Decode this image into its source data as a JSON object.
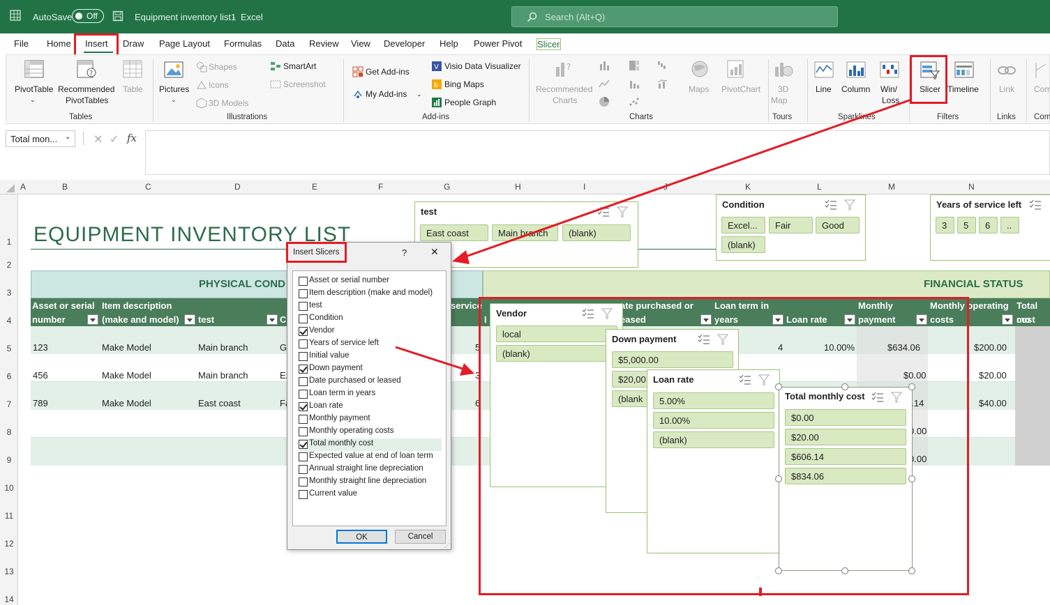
{
  "titlebar": {
    "autosave_label": "AutoSave",
    "autosave_state": "Off",
    "document_title": "Equipment inventory list1",
    "separator": "-",
    "app_name": "Excel",
    "search_placeholder": "Search (Alt+Q)"
  },
  "tabs": [
    "File",
    "Home",
    "Insert",
    "Draw",
    "Page Layout",
    "Formulas",
    "Data",
    "Review",
    "View",
    "Developer",
    "Help",
    "Power Pivot",
    "Slicer"
  ],
  "ribbon": {
    "tables": {
      "pivottable": "PivotTable",
      "recommended_1": "Recommended",
      "recommended_2": "PivotTables",
      "table": "Table",
      "group": "Tables"
    },
    "illustrations": {
      "pictures": "Pictures",
      "shapes": "Shapes",
      "icons": "Icons",
      "models": "3D Models",
      "smartart": "SmartArt",
      "screenshot": "Screenshot",
      "group": "Illustrations"
    },
    "addins": {
      "get": "Get Add-ins",
      "my": "My Add-ins",
      "visio": "Visio Data Visualizer",
      "bing": "Bing Maps",
      "people": "People Graph",
      "group": "Add-ins"
    },
    "charts": {
      "rec_1": "Recommended",
      "rec_2": "Charts",
      "maps": "Maps",
      "pivotchart": "PivotChart",
      "group": "Charts"
    },
    "tours": {
      "map_1": "3D",
      "map_2": "Map",
      "group": "Tours"
    },
    "sparklines": {
      "line": "Line",
      "column": "Column",
      "winloss_1": "Win/",
      "winloss_2": "Loss",
      "group": "Sparklines"
    },
    "filters": {
      "slicer": "Slicer",
      "timeline": "Timeline",
      "group": "Filters"
    },
    "links": {
      "link": "Link",
      "group": "Links"
    },
    "comments": {
      "com": "Com",
      "group": "Com"
    }
  },
  "formula": {
    "namebox": "Total mon...",
    "fx": "fx"
  },
  "columns": [
    "A",
    "B",
    "C",
    "D",
    "E",
    "F",
    "G",
    "H",
    "I",
    "J",
    "K",
    "L",
    "M",
    "N"
  ],
  "rows": [
    "1",
    "2",
    "3",
    "4",
    "5",
    "6",
    "7",
    "8",
    "9",
    "10",
    "11",
    "12",
    "13",
    "14"
  ],
  "sheet": {
    "title": "EQUIPMENT INVENTORY LIST",
    "physical": "PHYSICAL COND",
    "financial": "FINANCIAL STATUS",
    "headers": {
      "asset_1": "Asset or serial",
      "asset_2": "number",
      "item_1": "Item description",
      "item_2": "(make and model)",
      "test": "test",
      "c": "C",
      "service": "service",
      "i": "I",
      "date_1": "ate purchased or",
      "date_2": "eased",
      "loan_1": "Loan term in",
      "loan_2": "years",
      "rate": "Loan rate",
      "monthly_1": "Monthly",
      "monthly_2": "payment",
      "op_1": "Monthly operating",
      "op_2": "costs",
      "tot_1": "Total mo",
      "tot_2": "cost"
    },
    "data_rows": [
      {
        "asset": "123",
        "item": "Make Model",
        "test": "Main branch",
        "cond": "G",
        "g": "5",
        "loan_term": "4",
        "rate": "10.00%",
        "payment": "$634.06",
        "op": "$200.00"
      },
      {
        "asset": "456",
        "item": "Make Model",
        "test": "Main branch",
        "cond": "Ex",
        "g": "3",
        "loan_term": "",
        "rate": "",
        "payment": "$0.00",
        "op": "$20.00"
      },
      {
        "asset": "789",
        "item": "Make Model",
        "test": "East coast",
        "cond": "Fa",
        "g": "6",
        "loan_term": "",
        "rate": "",
        "payment": "5.14",
        "op": "$40.00"
      }
    ],
    "row8_m": "0.00",
    "row9_m": "0.00"
  },
  "slicers": {
    "test": {
      "title": "test",
      "items": [
        "East coast",
        "Main branch",
        "(blank)"
      ]
    },
    "condition": {
      "title": "Condition",
      "items": [
        "Excel...",
        "Fair",
        "Good",
        "(blank)"
      ]
    },
    "years": {
      "title": "Years of service left",
      "items": [
        "3",
        "5",
        "6",
        ".."
      ]
    },
    "vendor": {
      "title": "Vendor",
      "items": [
        "local",
        "(blank)"
      ]
    },
    "down": {
      "title": "Down payment",
      "items": [
        "$5,000.00",
        "$20,00",
        "(blank"
      ]
    },
    "loanrate": {
      "title": "Loan rate",
      "items": [
        "5.00%",
        "10.00%",
        "(blank)"
      ]
    },
    "total": {
      "title": "Total monthly cost",
      "items": [
        "$0.00",
        "$20.00",
        "$606.14",
        "$834.06"
      ]
    }
  },
  "dialog": {
    "title": "Insert Slicers",
    "help": "?",
    "close": "✕",
    "fields": [
      {
        "label": "Asset or serial number",
        "checked": false
      },
      {
        "label": "Item description (make and model)",
        "checked": false
      },
      {
        "label": "test",
        "checked": false
      },
      {
        "label": "Condition",
        "checked": false
      },
      {
        "label": "Vendor",
        "checked": true
      },
      {
        "label": "Years of service left",
        "checked": false
      },
      {
        "label": "Initial value",
        "checked": false
      },
      {
        "label": "Down payment",
        "checked": true
      },
      {
        "label": "Date purchased or leased",
        "checked": false
      },
      {
        "label": "Loan term in years",
        "checked": false
      },
      {
        "label": "Loan rate",
        "checked": true
      },
      {
        "label": "Monthly payment",
        "checked": false
      },
      {
        "label": "Monthly operating costs",
        "checked": false
      },
      {
        "label": "Total monthly cost",
        "checked": true
      },
      {
        "label": "Expected value at end of loan term",
        "checked": false
      },
      {
        "label": "Annual straight line depreciation",
        "checked": false
      },
      {
        "label": "Monthly straight line depreciation",
        "checked": false
      },
      {
        "label": "Current value",
        "checked": false
      }
    ],
    "ok": "OK",
    "cancel": "Cancel"
  },
  "colors": {
    "excel_green": "#217346",
    "header_green": "#4a7d5a",
    "band_light": "#e2f0e7",
    "financial_band": "#d9e9c2",
    "annotation_red": "#e31c25"
  }
}
